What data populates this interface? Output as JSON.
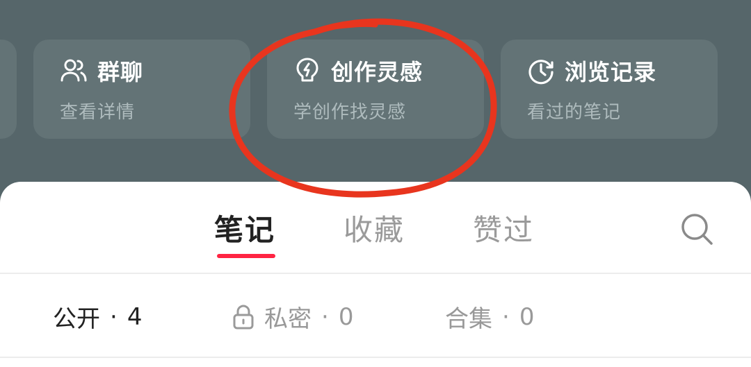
{
  "cards": [
    {
      "title": "群聊",
      "subtitle": "查看详情",
      "icon": "group-users-icon"
    },
    {
      "title": "创作灵感",
      "subtitle": "学创作找灵感",
      "icon": "lightbulb-bolt-icon"
    },
    {
      "title": "浏览记录",
      "subtitle": "看过的笔记",
      "icon": "clock-history-icon"
    }
  ],
  "tabs": [
    {
      "label": "笔记",
      "active": true
    },
    {
      "label": "收藏",
      "active": false
    },
    {
      "label": "赞过",
      "active": false
    }
  ],
  "search": {
    "icon": "search-icon"
  },
  "filters": [
    {
      "label": "公开",
      "count": "4",
      "active": true
    },
    {
      "label": "私密",
      "count": "0",
      "active": false,
      "icon": "lock-icon"
    },
    {
      "label": "合集",
      "count": "0",
      "active": false
    }
  ],
  "colors": {
    "background": "#56666a",
    "card": "#637376",
    "accent": "#ff2442",
    "annotation": "#e8351e"
  }
}
